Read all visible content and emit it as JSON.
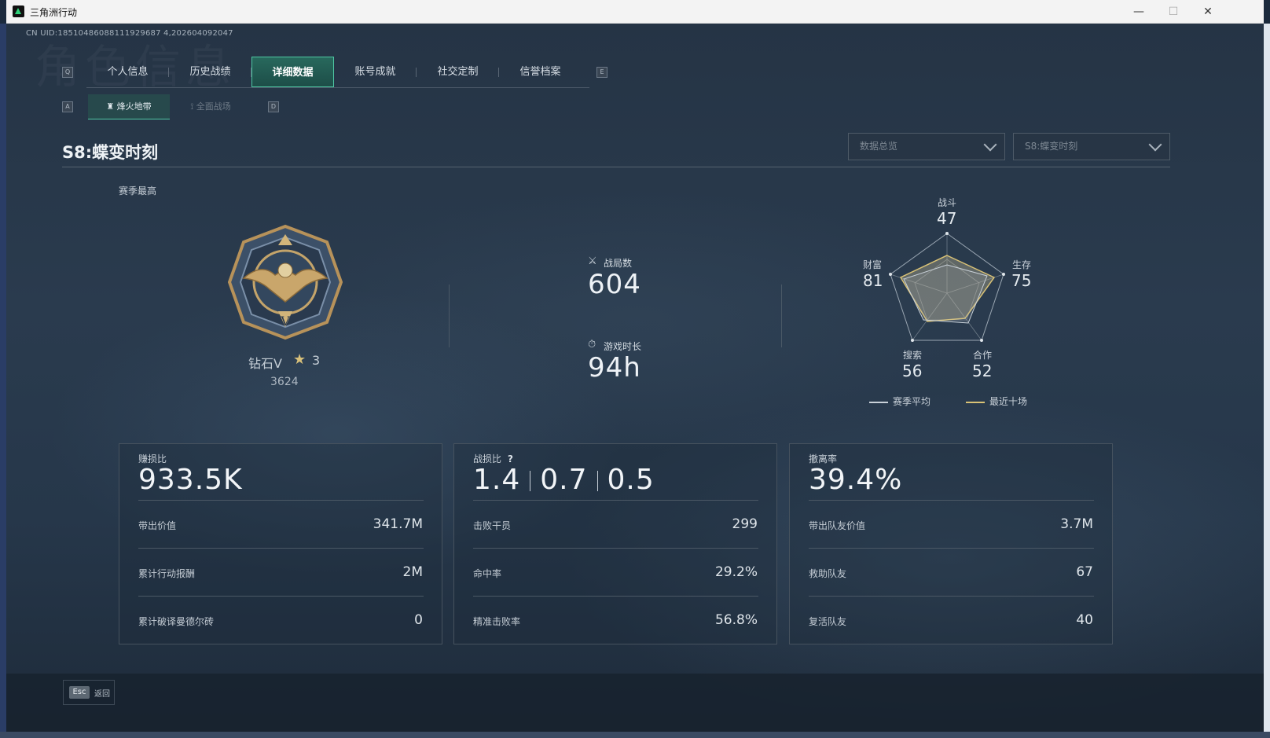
{
  "window": {
    "title": "三角洲行动",
    "minimize": "—",
    "maximize": "☐",
    "close": "✕"
  },
  "uid": "CN UID:18510486088111929687 4,202604092047",
  "watermark": "角色信息",
  "key_hints": {
    "nav_prev": "Q",
    "nav_next": "E",
    "sub_prev": "A",
    "sub_next": "D"
  },
  "nav_tabs": [
    {
      "label": "个人信息",
      "active": false
    },
    {
      "label": "历史战绩",
      "active": false
    },
    {
      "label": "详细数据",
      "active": true
    },
    {
      "label": "账号成就",
      "active": false
    },
    {
      "label": "社交定制",
      "active": false
    },
    {
      "label": "信誉档案",
      "active": false
    }
  ],
  "sub_tabs": [
    {
      "label": "烽火地带",
      "icon": "tower-icon",
      "active": true
    },
    {
      "label": "全面战场",
      "icon": "trident-icon",
      "active": false
    }
  ],
  "season_title": "S8:蝶变时刻",
  "dropdowns": {
    "data_type": "数据总览",
    "season": "S8:蝶变时刻"
  },
  "rank": {
    "section_label": "赛季最高",
    "name": "钻石V",
    "stars": "3",
    "score": "3624"
  },
  "center_stats": {
    "matches_label": "战局数",
    "matches_value": "604",
    "playtime_label": "游戏时长",
    "playtime_value": "94h"
  },
  "radar": {
    "labels": {
      "combat": "战斗",
      "survival": "生存",
      "coop": "合作",
      "search": "搜索",
      "wealth": "财富"
    },
    "values": {
      "combat": "47",
      "survival": "75",
      "coop": "52",
      "search": "56",
      "wealth": "81"
    },
    "legend": {
      "season_avg": "赛季平均",
      "recent_ten": "最近十场"
    },
    "colors": {
      "season_avg": "#c9d1d9",
      "recent_ten": "#d9c276"
    }
  },
  "cards": {
    "profit": {
      "label": "赚损比",
      "main": "933.5K",
      "rows": [
        {
          "label": "带出价值",
          "value": "341.7M"
        },
        {
          "label": "累计行动报酬",
          "value": "2M"
        },
        {
          "label": "累计破译曼德尔砖",
          "value": "0"
        }
      ]
    },
    "combat": {
      "label": "战损比",
      "help": "?",
      "ratios": [
        "1.4",
        "0.7",
        "0.5"
      ],
      "rows": [
        {
          "label": "击败干员",
          "value": "299"
        },
        {
          "label": "命中率",
          "value": "29.2%"
        },
        {
          "label": "精准击败率",
          "value": "56.8%"
        }
      ]
    },
    "extract": {
      "label": "撤离率",
      "main": "39.4%",
      "rows": [
        {
          "label": "带出队友价值",
          "value": "3.7M"
        },
        {
          "label": "救助队友",
          "value": "67"
        },
        {
          "label": "复活队友",
          "value": "40"
        }
      ]
    }
  },
  "bottom": {
    "esc_key": "Esc",
    "esc_label": "返回"
  }
}
